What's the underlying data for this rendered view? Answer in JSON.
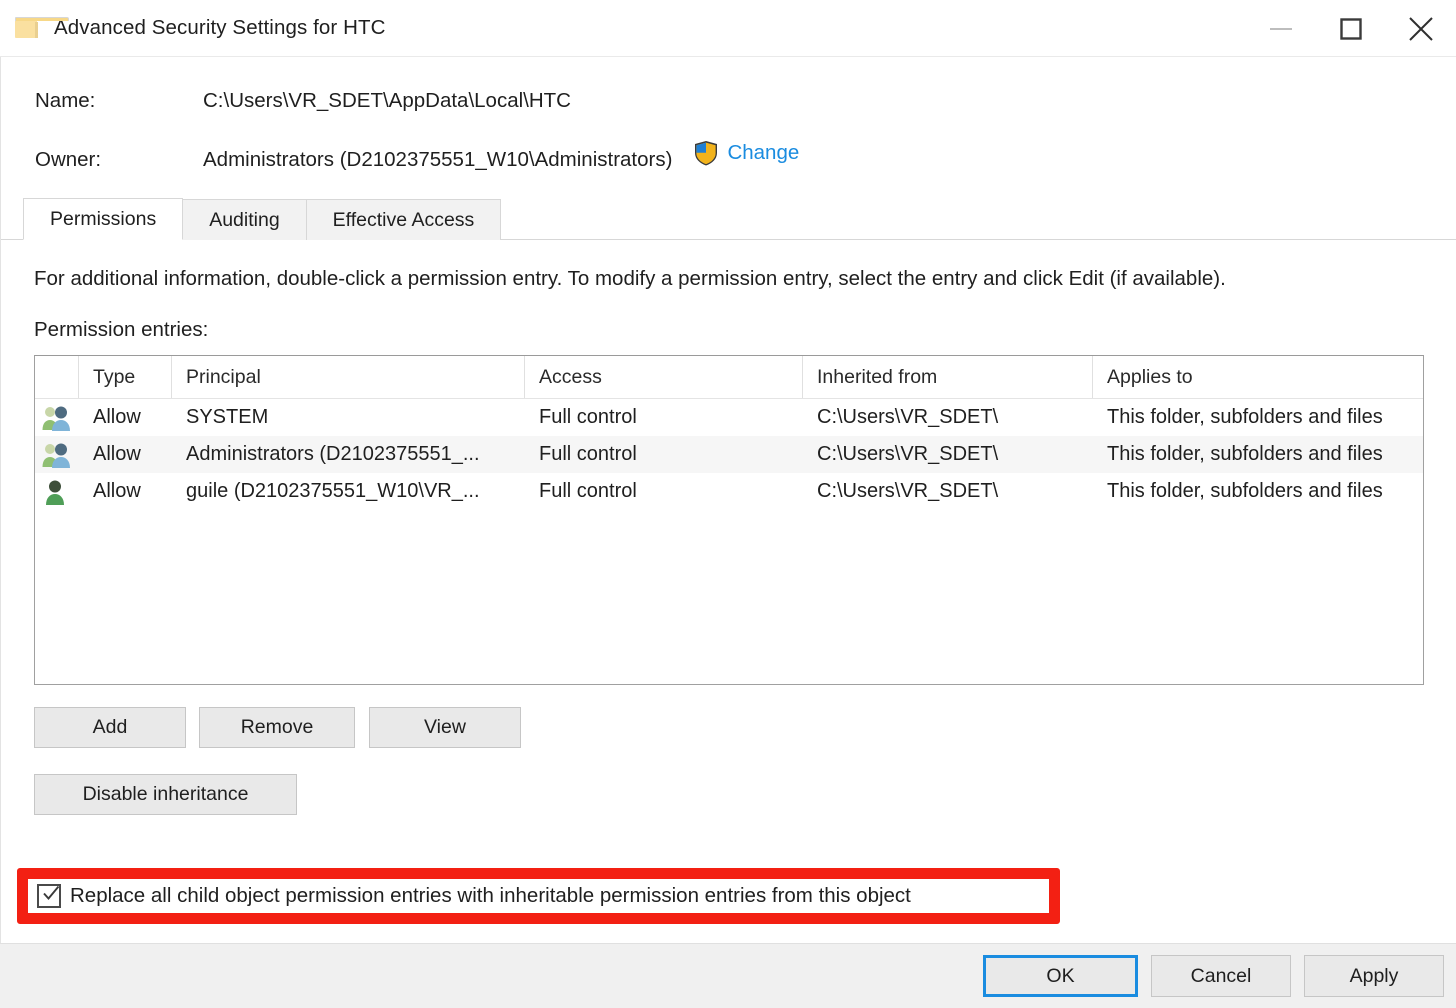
{
  "window": {
    "title": "Advanced Security Settings for HTC",
    "icon": "folder-icon",
    "minimize_label": "—",
    "maximize_label": "□",
    "close_label": "✕"
  },
  "fields": {
    "name_label": "Name:",
    "name_value": "C:\\Users\\VR_SDET\\AppData\\Local\\HTC",
    "owner_label": "Owner:",
    "owner_value": "Administrators (D2102375551_W10\\Administrators)",
    "change_link": "Change",
    "change_icon": "uac-shield-icon"
  },
  "tabs": [
    {
      "label": "Permissions",
      "active": true
    },
    {
      "label": "Auditing",
      "active": false
    },
    {
      "label": "Effective Access",
      "active": false
    }
  ],
  "main": {
    "info_text": "For additional information, double-click a permission entry. To modify a permission entry, select the entry and click Edit (if available).",
    "entries_label": "Permission entries:"
  },
  "table": {
    "columns": [
      "",
      "Type",
      "Principal",
      "Access",
      "Inherited from",
      "Applies to"
    ],
    "rows": [
      {
        "icon": "group-icon",
        "type": "Allow",
        "principal": "SYSTEM",
        "access": "Full control",
        "inherited_from": "C:\\Users\\VR_SDET\\",
        "applies_to": "This folder, subfolders and files",
        "selected": false
      },
      {
        "icon": "group-icon",
        "type": "Allow",
        "principal": "Administrators (D2102375551_...",
        "access": "Full control",
        "inherited_from": "C:\\Users\\VR_SDET\\",
        "applies_to": "This folder, subfolders and files",
        "selected": true
      },
      {
        "icon": "user-icon",
        "type": "Allow",
        "principal": "guile (D2102375551_W10\\VR_...",
        "access": "Full control",
        "inherited_from": "C:\\Users\\VR_SDET\\",
        "applies_to": "This folder, subfolders and files",
        "selected": false
      }
    ]
  },
  "actions": {
    "add": "Add",
    "remove": "Remove",
    "view": "View",
    "disable_inheritance": "Disable inheritance"
  },
  "replace_checkbox": {
    "label": "Replace all child object permission entries with inheritable permission entries from this object",
    "checked": true,
    "highlight_color": "#f32013"
  },
  "footer": {
    "ok": "OK",
    "cancel": "Cancel",
    "apply": "Apply"
  },
  "colors": {
    "link": "#1a8ce0",
    "focus_border": "#1a8ce0",
    "annotation": "#f32013",
    "button_face": "#e9e9e9",
    "footer_bg": "#f0f0f0"
  }
}
